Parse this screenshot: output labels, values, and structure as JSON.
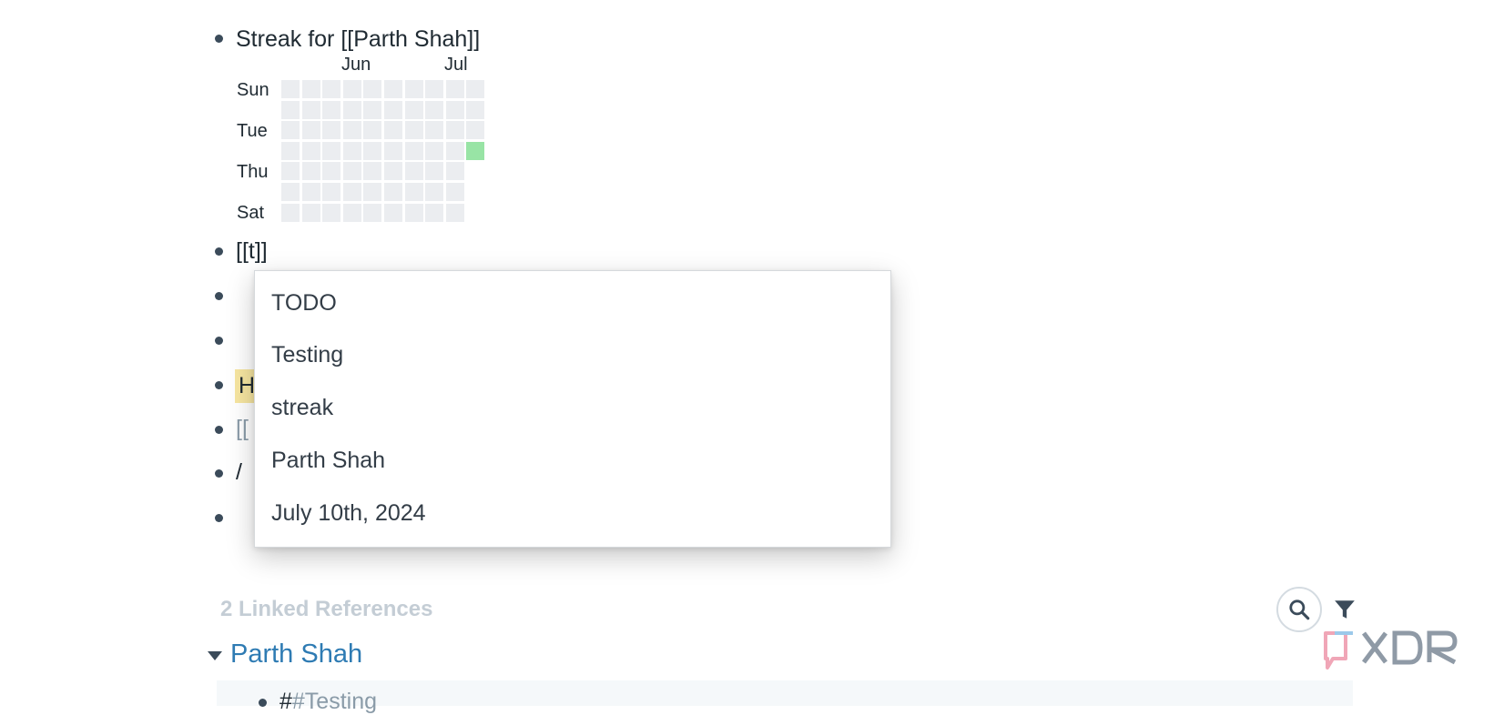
{
  "blocks": {
    "streak_title": "Streak for [[Parth Shah]]",
    "t_link": "[[t]]",
    "h_partial": "H",
    "bracket_partial": "[[",
    "slash": "/"
  },
  "streak": {
    "months": [
      "Jun",
      "Jul"
    ],
    "days": [
      "Sun",
      "Tue",
      "Thu",
      "Sat"
    ],
    "active_color": "#98e4a5",
    "empty_color": "#ebedf0"
  },
  "autocomplete": {
    "items": [
      "TODO",
      "Testing",
      "streak",
      "Parth Shah",
      "July 10th, 2024"
    ]
  },
  "references": {
    "count_label": "2 Linked References",
    "page_title": "Parth Shah",
    "first_block_hash": "#",
    "first_block_tag": "#Testing"
  },
  "icons": {
    "search": "search-icon",
    "filter": "filter-icon",
    "caret": "caret-down-icon",
    "logo": "xdr-logo"
  },
  "colors": {
    "link": "#2e7bb3",
    "highlight": "#f7e6a1",
    "muted": "#c4cdd5"
  }
}
